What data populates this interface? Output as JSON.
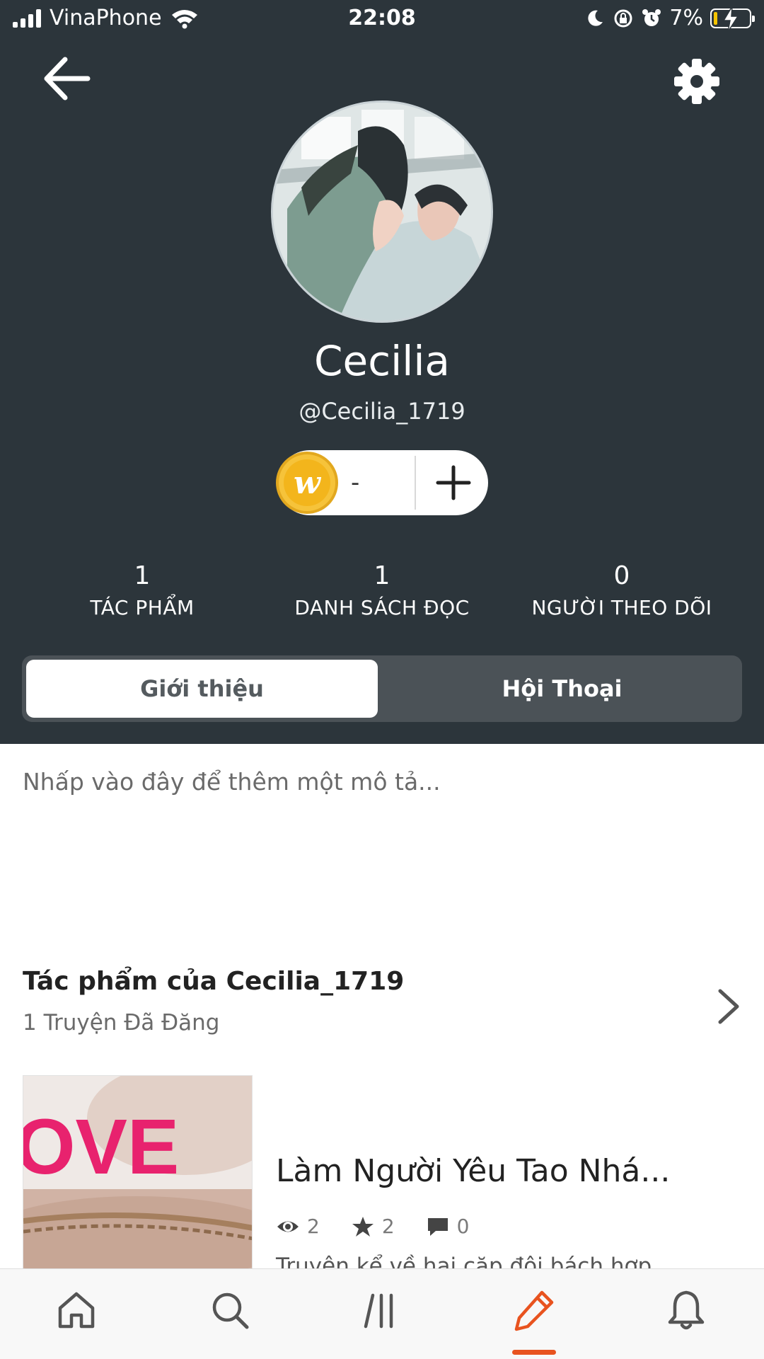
{
  "status_bar": {
    "carrier": "VinaPhone",
    "time": "22:08",
    "battery": "7%"
  },
  "profile": {
    "display_name": "Cecilia",
    "username": "@Cecilia_1719",
    "coin_balance": "-"
  },
  "stats": [
    {
      "value": "1",
      "label": "TÁC PHẨM"
    },
    {
      "value": "1",
      "label": "DANH SÁCH ĐỌC"
    },
    {
      "value": "0",
      "label": "NGƯỜI THEO DÕI"
    }
  ],
  "tabs": {
    "intro": "Giới thiệu",
    "conversation": "Hội Thoại",
    "selected": "intro"
  },
  "description_placeholder": "Nhấp vào đây để thêm một mô tả...",
  "works": {
    "title": "Tác phẩm của Cecilia_1719",
    "count_label": "1 Truyện Đã Đăng",
    "stories": [
      {
        "title": "Làm Người Yêu Tao Nhá...",
        "cover_text": "OVE",
        "reads": "2",
        "votes": "2",
        "comments": "0",
        "description": "Truyện kể về hai cặp đôi bách hợp,"
      }
    ]
  },
  "bottom_nav": {
    "items": [
      "home-icon",
      "search-icon",
      "library-icon",
      "write-icon",
      "bell-icon"
    ],
    "active": "write-icon"
  },
  "colors": {
    "header_bg": "#2c353b",
    "accent": "#e8531f",
    "coin": "#f6c33a",
    "cover_text": "#e8226e"
  }
}
